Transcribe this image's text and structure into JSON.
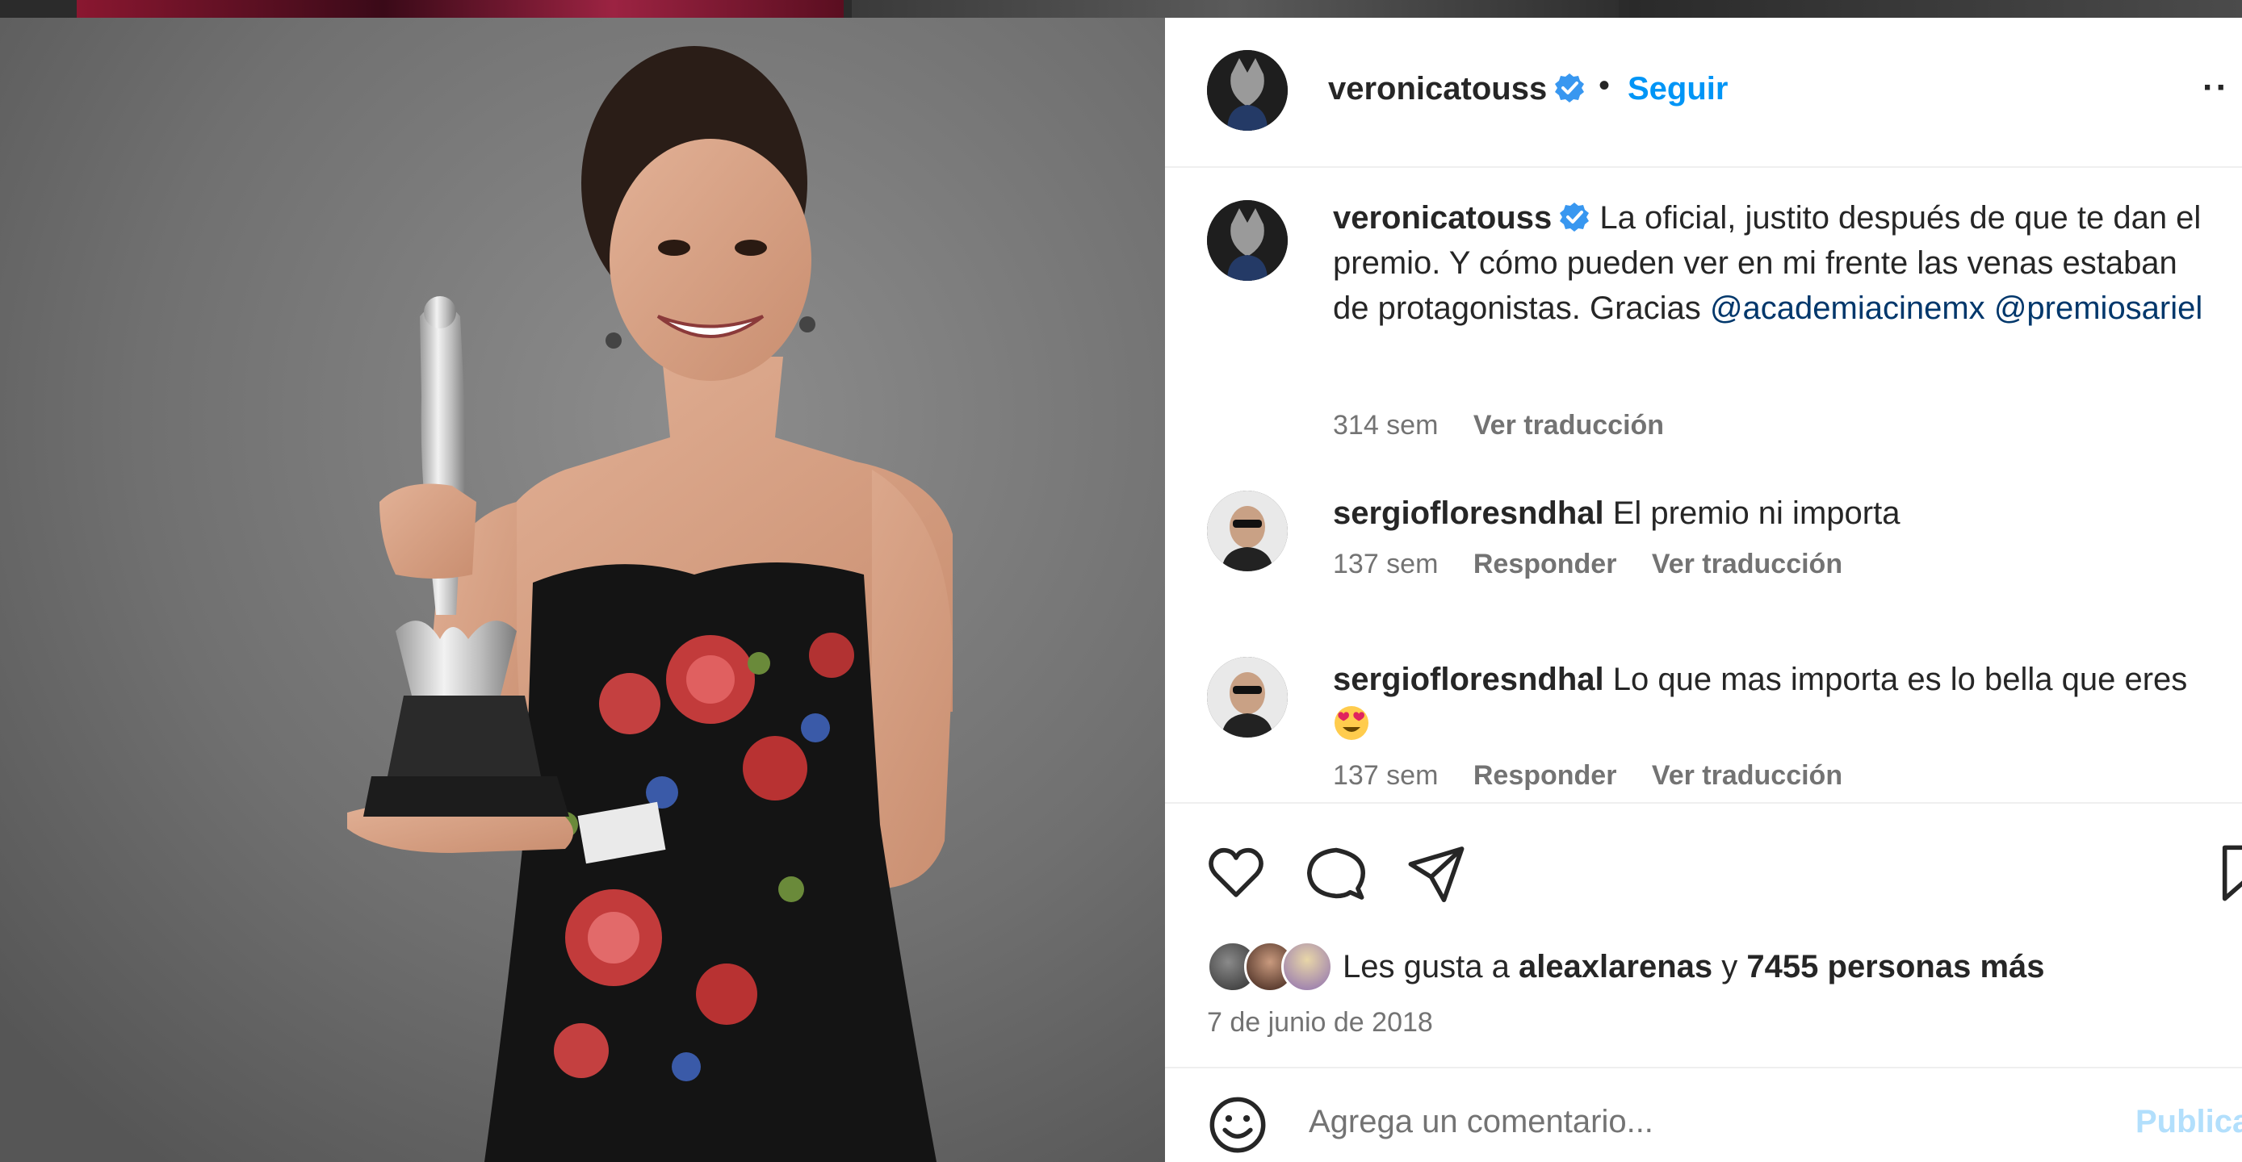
{
  "post": {
    "author": "veronicatouss",
    "follow_label": "Seguir",
    "separator": "•",
    "more_label": "··"
  },
  "caption": {
    "username": "veronicatouss",
    "text": "La oficial, justito después de que te dan el premio. Y cómo pueden ver en mi frente las venas estaban de protagonistas. Gracias",
    "mention1": "@academiacinemx",
    "mention2": "@premiosariel",
    "time": "314 sem",
    "translate": "Ver traducción"
  },
  "comments": [
    {
      "username": "sergiofloresndhal",
      "text": "El premio ni importa",
      "time": "137 sem",
      "reply": "Responder",
      "translate": "Ver traducción"
    },
    {
      "username": "sergiofloresndhal",
      "text": "Lo que mas importa es lo bella que eres",
      "time": "137 sem",
      "reply": "Responder",
      "translate": "Ver traducción"
    }
  ],
  "likes": {
    "prefix": "Les gusta a",
    "first_user": "aleaxlarenas",
    "connector": "y",
    "count_text": "7455 personas más"
  },
  "date": "7 de junio de 2018",
  "composer": {
    "placeholder": "Agrega un comentario...",
    "publish": "Publicar"
  },
  "colors": {
    "accent": "#0095f6",
    "mention": "#00376b",
    "verified": "#3897f0",
    "muted": "#737373"
  },
  "icons": [
    "verified-badge-icon",
    "heart-icon",
    "comment-icon",
    "share-icon",
    "bookmark-icon",
    "emoji-icon"
  ]
}
